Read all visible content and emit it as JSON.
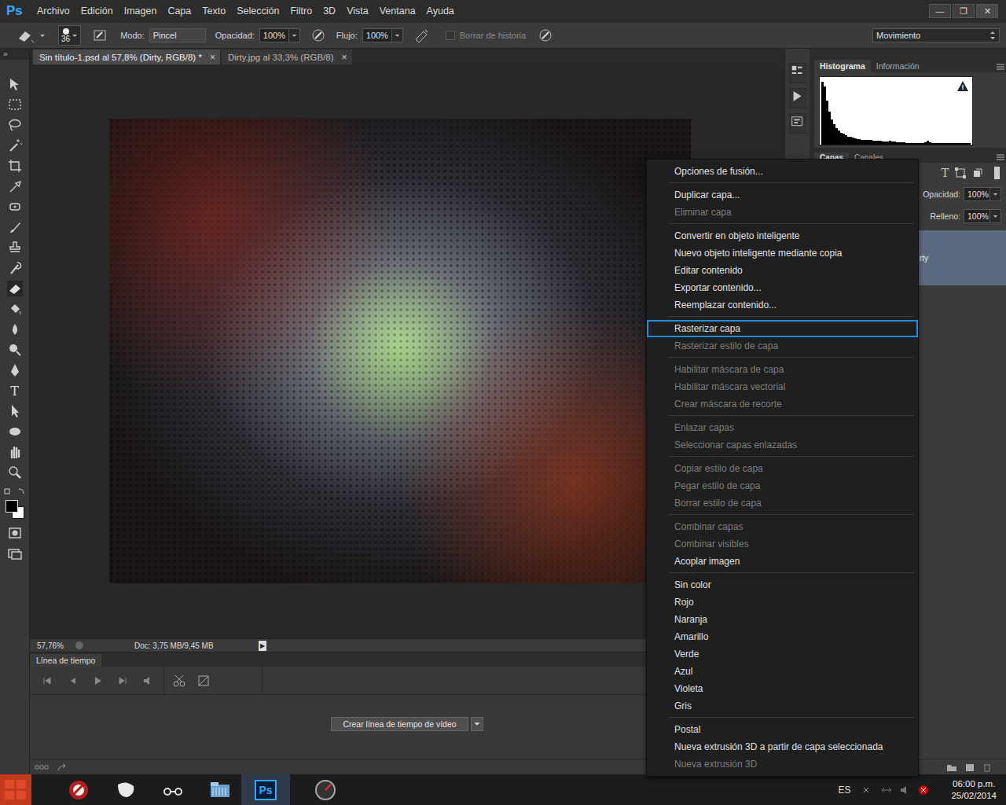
{
  "app": {
    "logo": "Ps"
  },
  "menu_bar": [
    "Archivo",
    "Edición",
    "Imagen",
    "Capa",
    "Texto",
    "Selección",
    "Filtro",
    "3D",
    "Vista",
    "Ventana",
    "Ayuda"
  ],
  "window_controls": [
    "—",
    "❐",
    "✕"
  ],
  "options_bar": {
    "brush_size": "36",
    "mode_label": "Modo:",
    "mode": "Pincel",
    "opacity_label": "Opacidad:",
    "opacity": "100%",
    "flow_label": "Flujo:",
    "flow": "100%",
    "erase_history": {
      "label": "Borrar de historia",
      "checked": false
    },
    "workspace": "Movimiento"
  },
  "document_tabs": [
    {
      "label": "Sin título-1.psd al 57,8% (Dirty, RGB/8) *",
      "selected": true,
      "close": "×"
    },
    {
      "label": "Dirty.jpg al 33,3% (RGB/8)",
      "selected": false,
      "close": "×"
    }
  ],
  "toolbar": {
    "collapse": "»",
    "type_tool": "T"
  },
  "status_bar": {
    "zoom": "57,76%",
    "doc": "Doc: 3,75 MB/9,45 MB",
    "arrow": "▶"
  },
  "timeline": {
    "title": "Línea de tiempo",
    "create_button": "Crear línea de tiempo de vídeo"
  },
  "histogram_panel": {
    "tabs": [
      {
        "label": "Histograma",
        "selected": true
      },
      {
        "label": "Información",
        "selected": false
      }
    ],
    "warning": "!",
    "values": [
      100,
      92,
      70,
      52,
      40,
      32,
      26,
      22,
      19,
      17,
      15,
      13,
      12,
      11,
      10,
      9,
      9,
      8,
      8,
      7,
      7,
      7,
      6,
      6,
      6,
      6,
      5,
      5,
      5,
      6,
      5,
      5,
      4,
      4,
      4,
      4,
      3,
      3,
      3,
      3,
      3,
      3,
      3,
      3,
      4,
      6,
      4,
      3,
      3,
      3,
      2,
      2,
      2,
      2,
      2,
      2,
      2,
      2,
      2,
      2,
      2,
      2,
      2,
      2
    ]
  },
  "layers_panel": {
    "tabs": [
      {
        "label": "Capas",
        "selected": true
      },
      {
        "label": "Canales",
        "selected": false
      }
    ],
    "filter_type": "T",
    "opacity_label": "Opacidad:",
    "opacity": "100%",
    "fill_label": "Relleno:",
    "fill": "100%",
    "layers": [
      {
        "name": "rty",
        "selected": true
      }
    ]
  },
  "context_menu": {
    "groups": [
      [
        {
          "label": "Opciones de fusión...",
          "disabled": false,
          "selected": false
        }
      ],
      [
        {
          "label": "Duplicar capa...",
          "disabled": false,
          "selected": false
        },
        {
          "label": "Eliminar capa",
          "disabled": true,
          "selected": false
        }
      ],
      [
        {
          "label": "Convertir en objeto inteligente",
          "disabled": false,
          "selected": false
        },
        {
          "label": "Nuevo objeto inteligente mediante copia",
          "disabled": false,
          "selected": false
        },
        {
          "label": "Editar contenido",
          "disabled": false,
          "selected": false
        },
        {
          "label": "Exportar contenido...",
          "disabled": false,
          "selected": false
        },
        {
          "label": "Reemplazar contenido...",
          "disabled": false,
          "selected": false
        }
      ],
      [
        {
          "label": "Rasterizar capa",
          "disabled": false,
          "selected": true
        },
        {
          "label": "Rasterizar estilo de capa",
          "disabled": true,
          "selected": false
        }
      ],
      [
        {
          "label": "Habilitar máscara de capa",
          "disabled": true,
          "selected": false
        },
        {
          "label": "Habilitar máscara vectorial",
          "disabled": true,
          "selected": false
        },
        {
          "label": "Crear máscara de recorte",
          "disabled": true,
          "selected": false
        }
      ],
      [
        {
          "label": "Enlazar capas",
          "disabled": true,
          "selected": false
        },
        {
          "label": "Seleccionar capas enlazadas",
          "disabled": true,
          "selected": false
        }
      ],
      [
        {
          "label": "Copiar estilo de capa",
          "disabled": true,
          "selected": false
        },
        {
          "label": "Pegar estilo de capa",
          "disabled": true,
          "selected": false
        },
        {
          "label": "Borrar estilo de capa",
          "disabled": true,
          "selected": false
        }
      ],
      [
        {
          "label": "Combinar capas",
          "disabled": true,
          "selected": false
        },
        {
          "label": "Combinar visibles",
          "disabled": true,
          "selected": false
        },
        {
          "label": "Acoplar imagen",
          "disabled": false,
          "selected": false
        }
      ],
      [
        {
          "label": "Sin color",
          "disabled": false,
          "selected": false
        },
        {
          "label": "Rojo",
          "disabled": false,
          "selected": false
        },
        {
          "label": "Naranja",
          "disabled": false,
          "selected": false
        },
        {
          "label": "Amarillo",
          "disabled": false,
          "selected": false
        },
        {
          "label": "Verde",
          "disabled": false,
          "selected": false
        },
        {
          "label": "Azul",
          "disabled": false,
          "selected": false
        },
        {
          "label": "Violeta",
          "disabled": false,
          "selected": false
        },
        {
          "label": "Gris",
          "disabled": false,
          "selected": false
        }
      ],
      [
        {
          "label": "Postal",
          "disabled": false,
          "selected": false
        },
        {
          "label": "Nueva extrusión 3D a partir de capa seleccionada",
          "disabled": false,
          "selected": false
        },
        {
          "label": "Nueva extrusión 3D",
          "disabled": true,
          "selected": false
        }
      ]
    ]
  },
  "taskbar": {
    "ps_icon": "Ps",
    "language": "ES",
    "time": "06:00 p.m.",
    "date": "25/02/2014"
  }
}
